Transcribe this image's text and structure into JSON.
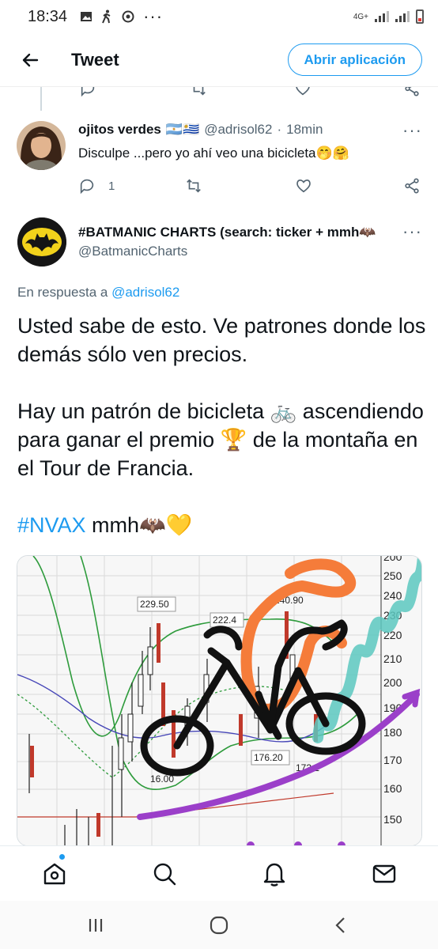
{
  "status_bar": {
    "time": "18:34",
    "dots": "···",
    "network": "4G+"
  },
  "app_bar": {
    "title": "Tweet",
    "open_app_label": "Abrir aplicación"
  },
  "reply_tweet": {
    "display_name": "ojitos verdes",
    "flags": "🇦🇷🇺🇾",
    "handle": "@adrisol62",
    "separator": "·",
    "time": "18min",
    "text": "Disculpe ...pero yo ahí veo una bicicleta🤭🤗",
    "reply_count": "1",
    "icons": [
      "reply-icon",
      "retweet-icon",
      "like-icon",
      "share-icon"
    ]
  },
  "main_tweet": {
    "display_name": "#BATMANIC CHARTS (search: ticker + mmh🦇",
    "handle": "@BatmanicCharts",
    "replying_prefix": "En respuesta a",
    "replying_to": "@adrisol62",
    "paragraph1": "Usted sabe de esto. Ve patrones donde los demás sólo ven precios.",
    "paragraph2": "Hay un patrón de bicicleta 🚲 ascendiendo para ganar el premio 🏆 de la montaña en el Tour de Francia.",
    "hashtag": "#NVAX",
    "hashtag_tail": " mmh🦇💛"
  },
  "chart_image": {
    "axis_labels": [
      "200",
      "250",
      "240",
      "230",
      "220",
      "210",
      "200",
      "190",
      "180",
      "170",
      "160",
      "150"
    ],
    "callouts": [
      "229.50",
      "222.4",
      "240.90",
      "176.20",
      "16.00",
      "173.1"
    ]
  },
  "bottom_nav": {
    "items": [
      "home-icon",
      "search-icon",
      "notifications-icon",
      "messages-icon"
    ]
  },
  "system_nav": {
    "items": [
      "recents-icon",
      "home-circle-icon",
      "back-icon"
    ]
  }
}
